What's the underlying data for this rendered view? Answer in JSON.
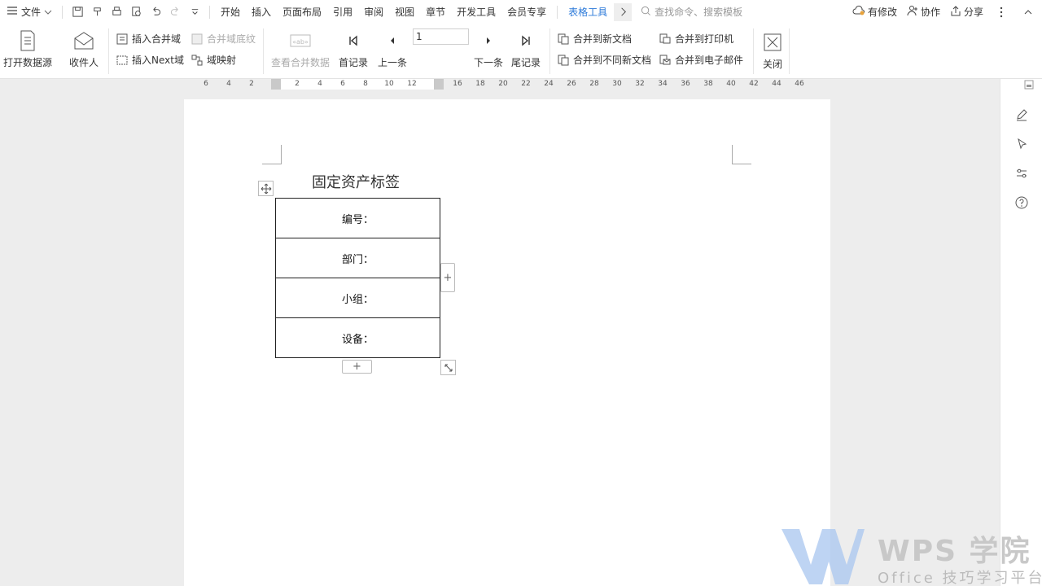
{
  "menubar": {
    "file": "文件",
    "tabs": [
      "开始",
      "插入",
      "页面布局",
      "引用",
      "审阅",
      "视图",
      "章节",
      "开发工具",
      "会员专享"
    ],
    "active_tab": "表格工具",
    "search_placeholder": "查找命令、搜索模板",
    "right": {
      "modify": "有修改",
      "collab": "协作",
      "share": "分享"
    }
  },
  "ribbon": {
    "open_source": "打开数据源",
    "recipients": "收件人",
    "insert_merge_field": "插入合并域",
    "merge_field_shading": "合并域底纹",
    "insert_next": "插入Next域",
    "field_mapping": "域映射",
    "view_merged": "查看合并数据",
    "first_record": "首记录",
    "prev": "上一条",
    "record_value": "1",
    "next": "下一条",
    "last_record": "尾记录",
    "merge_new_doc": "合并到新文档",
    "merge_diff_doc": "合并到不同新文档",
    "merge_printer": "合并到打印机",
    "merge_email": "合并到电子邮件",
    "close": "关闭"
  },
  "ruler": {
    "labels": [
      "6",
      "4",
      "2",
      "2",
      "4",
      "6",
      "8",
      "10",
      "12",
      "16",
      "18",
      "20",
      "22",
      "24",
      "26",
      "28",
      "30",
      "32",
      "34",
      "36",
      "38",
      "40",
      "42",
      "44",
      "46"
    ]
  },
  "document": {
    "title": "固定资产标签",
    "rows": [
      "编号：",
      "部门：",
      "小组：",
      "设备："
    ],
    "add_symbol": "+"
  },
  "watermark": {
    "brand": "WPS 学院",
    "sub": "Office 技巧学习平台"
  },
  "colors": {
    "accent": "#2b79d9",
    "watermark": "#c8c8c8",
    "logo": "#a8c6ef"
  }
}
